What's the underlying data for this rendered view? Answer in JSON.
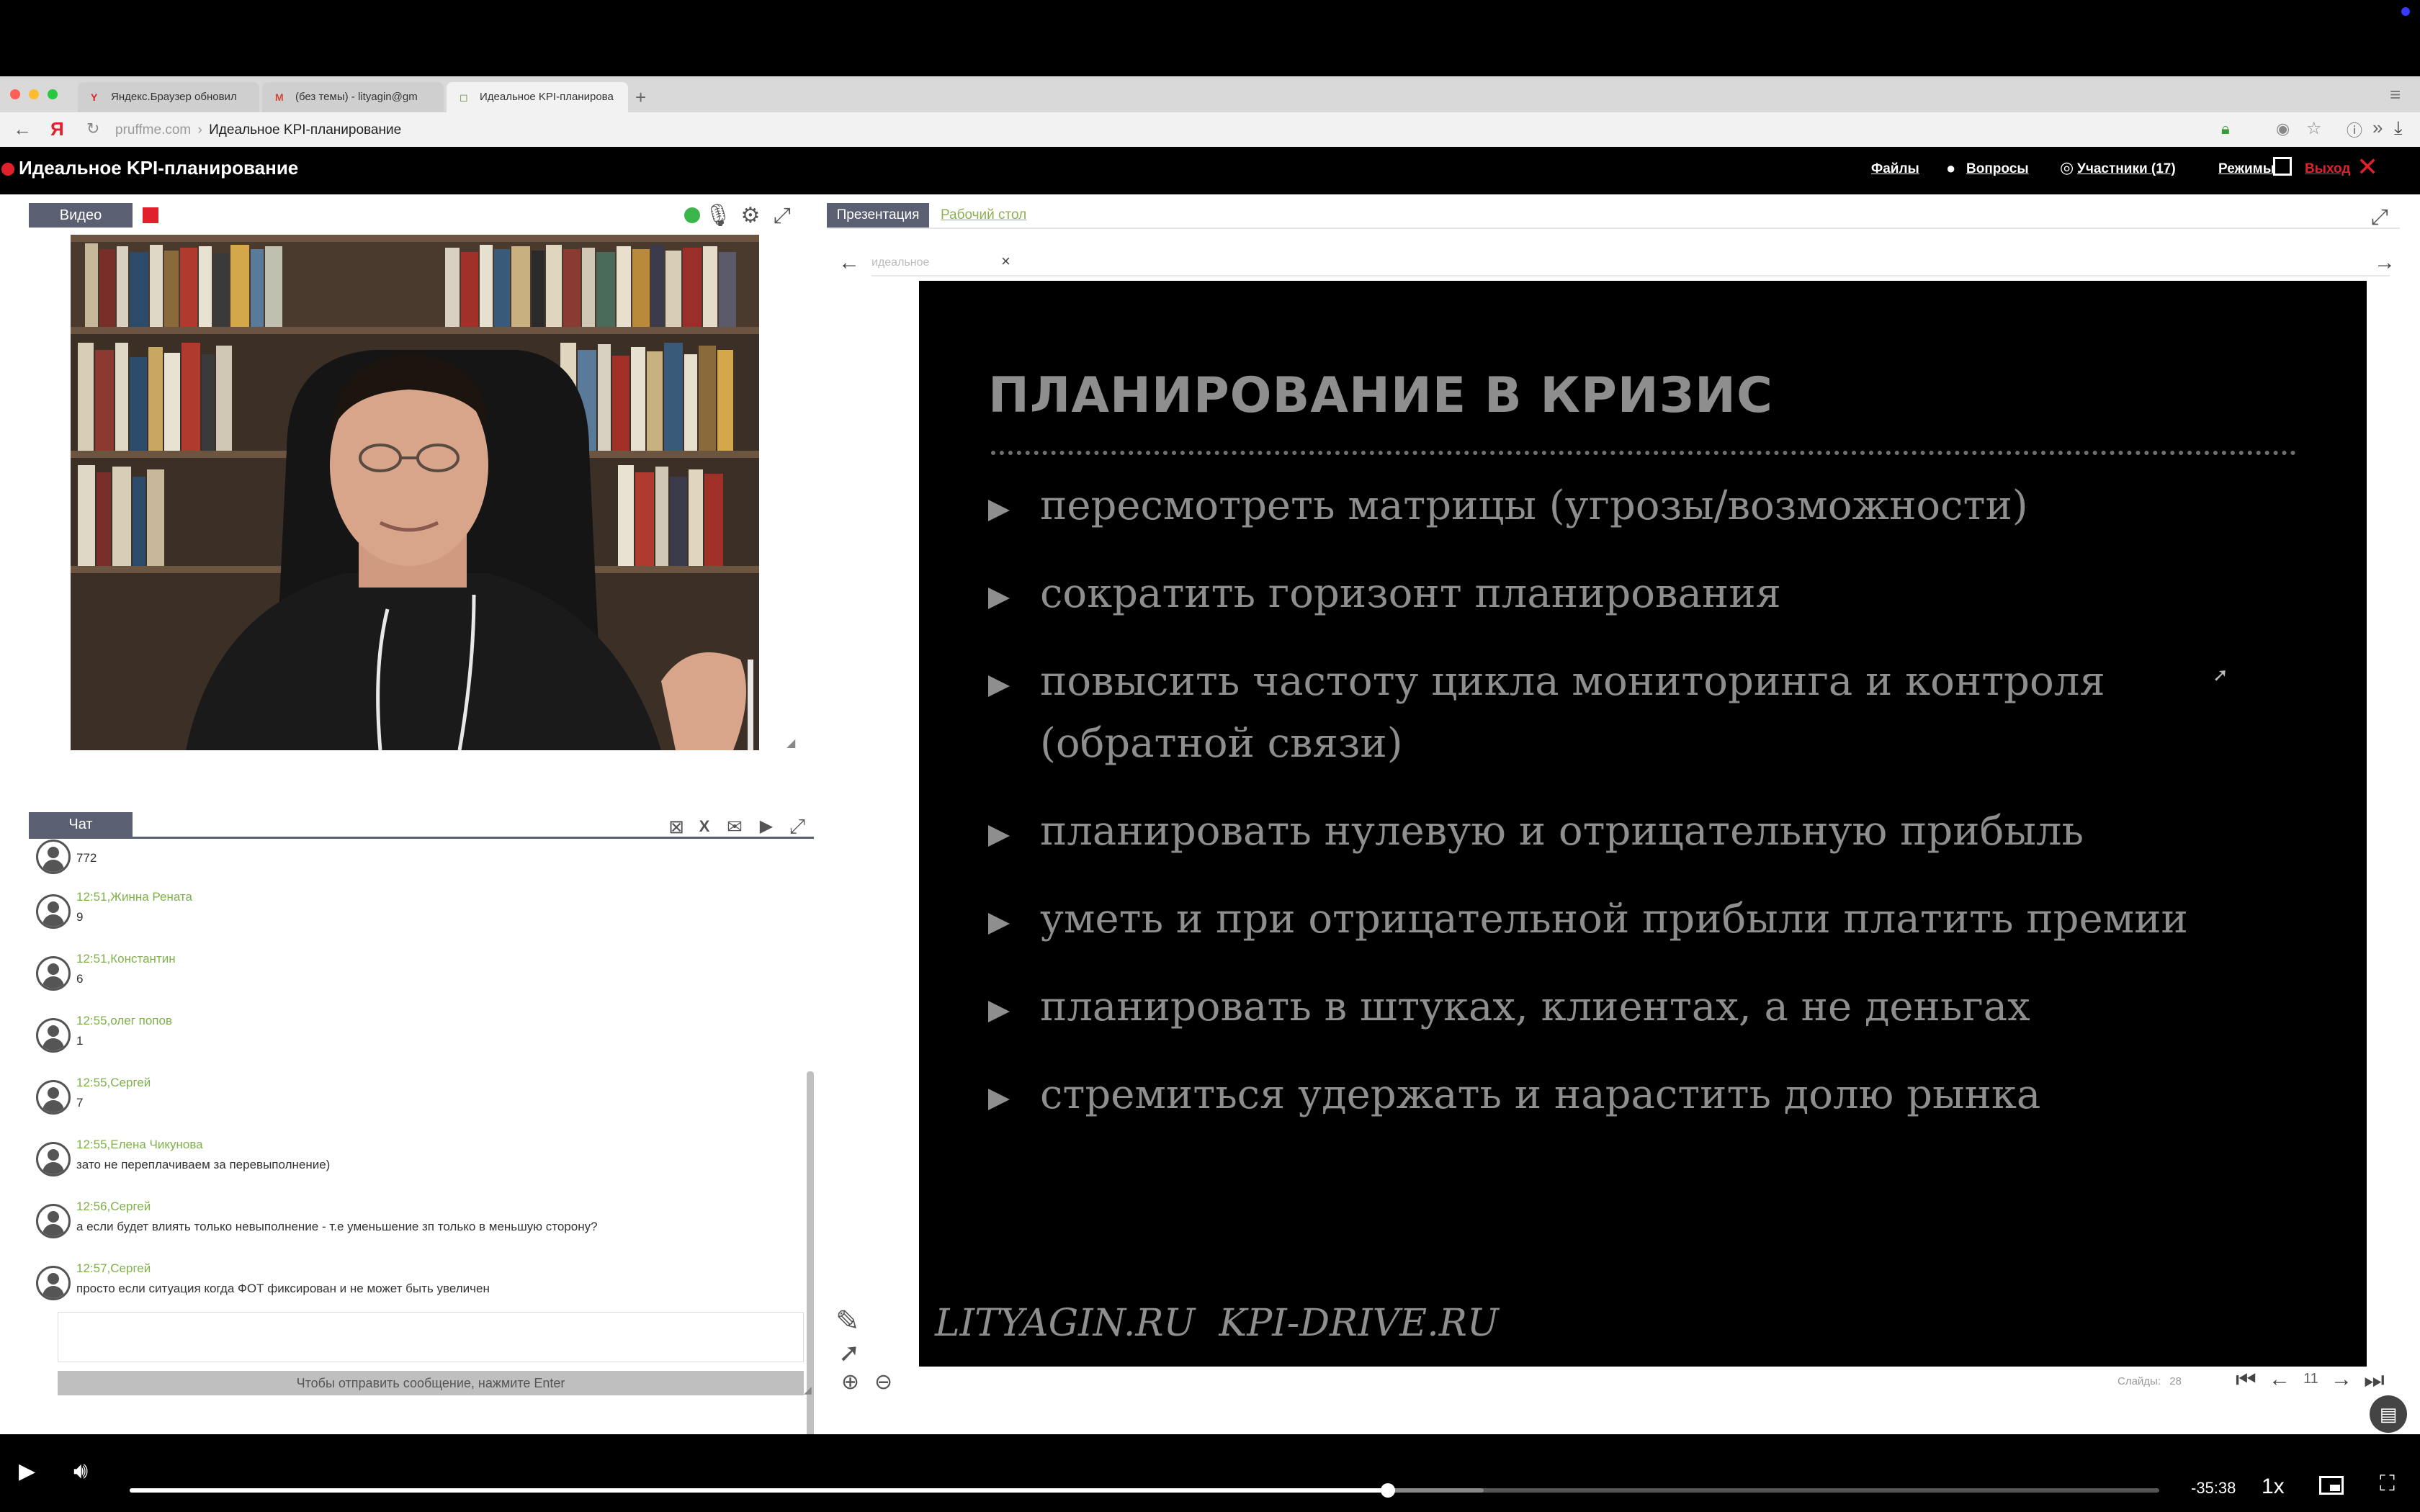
{
  "browser": {
    "tabs": [
      {
        "label": "Яндекс.Браузер обновил",
        "icon": "Y"
      },
      {
        "label": "(без темы) - lityagin@gm",
        "icon": "M"
      },
      {
        "label": "Идеальное KPI-планирова",
        "icon": "◻"
      }
    ],
    "new_tab": "+",
    "url_domain": "pruffme.com",
    "url_sep": "›",
    "url_title": "Идеальное KPI-планирование"
  },
  "app": {
    "title": "Идеальное KPI-планирование",
    "nav": {
      "files": "Файлы",
      "questions": "Вопросы",
      "participants": "Участники (17)",
      "modes": "Режимы",
      "exit": "Выход"
    }
  },
  "video_panel": {
    "tab_label": "Видео"
  },
  "chat": {
    "tab_label": "Чат",
    "partial_top_text": "772",
    "messages": [
      {
        "meta": "12:51,Жинна Рената",
        "text": "9"
      },
      {
        "meta": "12:51,Константин",
        "text": "6"
      },
      {
        "meta": "12:55,олег попов",
        "text": "1"
      },
      {
        "meta": "12:55,Сергей",
        "text": "7"
      },
      {
        "meta": "12:55,Елена Чикунова",
        "text": "зато не переплачиваем за перевыполнение)"
      },
      {
        "meta": "12:56,Сергей",
        "text": "а если будет влиять только невыполнение - т.е уменьшение зп только в меньшую сторону?"
      },
      {
        "meta": "12:57,Сергей",
        "text": "просто если ситуация когда ФОТ фиксирован и не может быть увеличен"
      }
    ],
    "input_value": "",
    "send_hint": "Чтобы отправить сообщение, нажмите Enter"
  },
  "presentation": {
    "tab_presentation": "Презентация",
    "tab_desktop": "Рабочий стол",
    "file_tab": "идеальное",
    "close": "×",
    "slide": {
      "title": "ПЛАНИРОВАНИЕ В КРИЗИС",
      "items": [
        "пересмотреть матрицы (угрозы/возможности)",
        "сократить горизонт планирования",
        "повысить частоту цикла мониторинга и контроля",
        "(обратной связи)",
        "планировать нулевую и отрицательную прибыль",
        "уметь и при отрицательной прибыли платить премии",
        "планировать в штуках, клиентах, а не деньгах",
        "стремиться удержать и нарастить долю рынка"
      ],
      "footer": "LITYAGIN.RU  KPI-DRIVE.RU"
    },
    "slides_label": "Слайды:",
    "slides_total": "28",
    "current_slide": "11"
  },
  "player": {
    "progress": 0.62,
    "buffered": 0.667,
    "time": "-35:38",
    "speed": "1x"
  },
  "colors": {
    "accent_green": "#7fb04a",
    "exit_red": "#e0202a",
    "tab_gray": "#5a6072"
  }
}
